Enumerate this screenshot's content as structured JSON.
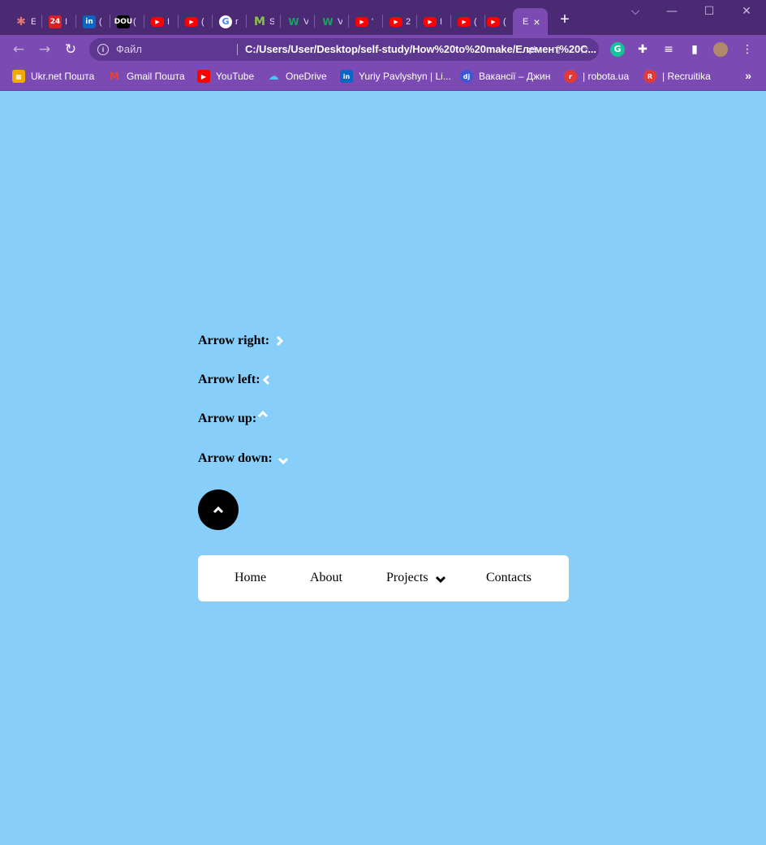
{
  "browser": {
    "tabs": [
      {
        "icon": "pinwheel-icon",
        "title": "E",
        "color": "#4a2a72"
      },
      {
        "icon": "24-icon",
        "title": "I",
        "color": "#d81f26",
        "text": "24"
      },
      {
        "icon": "linkedin-icon",
        "title": "(",
        "color": "#0a66c2",
        "text": "in"
      },
      {
        "icon": "dou-icon",
        "title": "(",
        "color": "#000000",
        "text": "DOU"
      },
      {
        "icon": "youtube-icon",
        "title": "I",
        "color": "#ff0000"
      },
      {
        "icon": "youtube-icon",
        "title": "(",
        "color": "#ff0000"
      },
      {
        "icon": "google-icon",
        "title": "r",
        "color": "#ffffff"
      },
      {
        "icon": "m-icon",
        "title": "S",
        "color": "#8bc34a"
      },
      {
        "icon": "w-icon",
        "title": "V",
        "color": "#1aa260"
      },
      {
        "icon": "w-icon",
        "title": "V",
        "color": "#1aa260"
      },
      {
        "icon": "youtube-icon",
        "title": "'",
        "color": "#ff0000"
      },
      {
        "icon": "youtube-icon",
        "title": "2",
        "color": "#ff0000"
      },
      {
        "icon": "youtube-icon",
        "title": "I",
        "color": "#ff0000"
      },
      {
        "icon": "youtube-icon",
        "title": "(",
        "color": "#ff0000"
      },
      {
        "icon": "youtube-icon",
        "title": "(",
        "color": "#ff0000"
      }
    ],
    "active_tab": {
      "title": "E",
      "close": "×"
    },
    "new_tab": "+",
    "address": {
      "file_label": "Файл",
      "url": "C:/Users/User/Desktop/self-study/How%20to%20make/Елемент%20C..."
    },
    "bookmarks": [
      {
        "label": "Ukr.net Пошта",
        "icon": "ukrnet-icon",
        "color": "#f2a900"
      },
      {
        "label": "Gmail Пошта",
        "icon": "gmail-icon",
        "color": "#ea4335"
      },
      {
        "label": "YouTube",
        "icon": "youtube-icon",
        "color": "#ff0000"
      },
      {
        "label": "OneDrive",
        "icon": "onedrive-icon",
        "color": "#0078d4"
      },
      {
        "label": "Yuriy Pavlyshyn | Li...",
        "icon": "linkedin-icon",
        "color": "#0a66c2"
      },
      {
        "label": "Вакансії – Джин",
        "icon": "djinni-icon",
        "color": "#3b57d9"
      },
      {
        "label": "| robota.ua",
        "icon": "robota-icon",
        "color": "#e53935"
      },
      {
        "label": "| Recruitika",
        "icon": "recruitika-icon",
        "color": "#e53935"
      }
    ],
    "more": "»"
  },
  "page": {
    "arrows": [
      {
        "label": "Arrow right:",
        "direction": "right"
      },
      {
        "label": "Arrow left:",
        "direction": "left"
      },
      {
        "label": "Arrow up:",
        "direction": "up"
      },
      {
        "label": "Arrow down:",
        "direction": "down"
      }
    ],
    "nav": {
      "home": "Home",
      "about": "About",
      "projects": "Projects",
      "contacts": "Contacts"
    },
    "colors": {
      "background": "#87cefa",
      "navbar": "#ffffff",
      "button": "#000000"
    }
  }
}
